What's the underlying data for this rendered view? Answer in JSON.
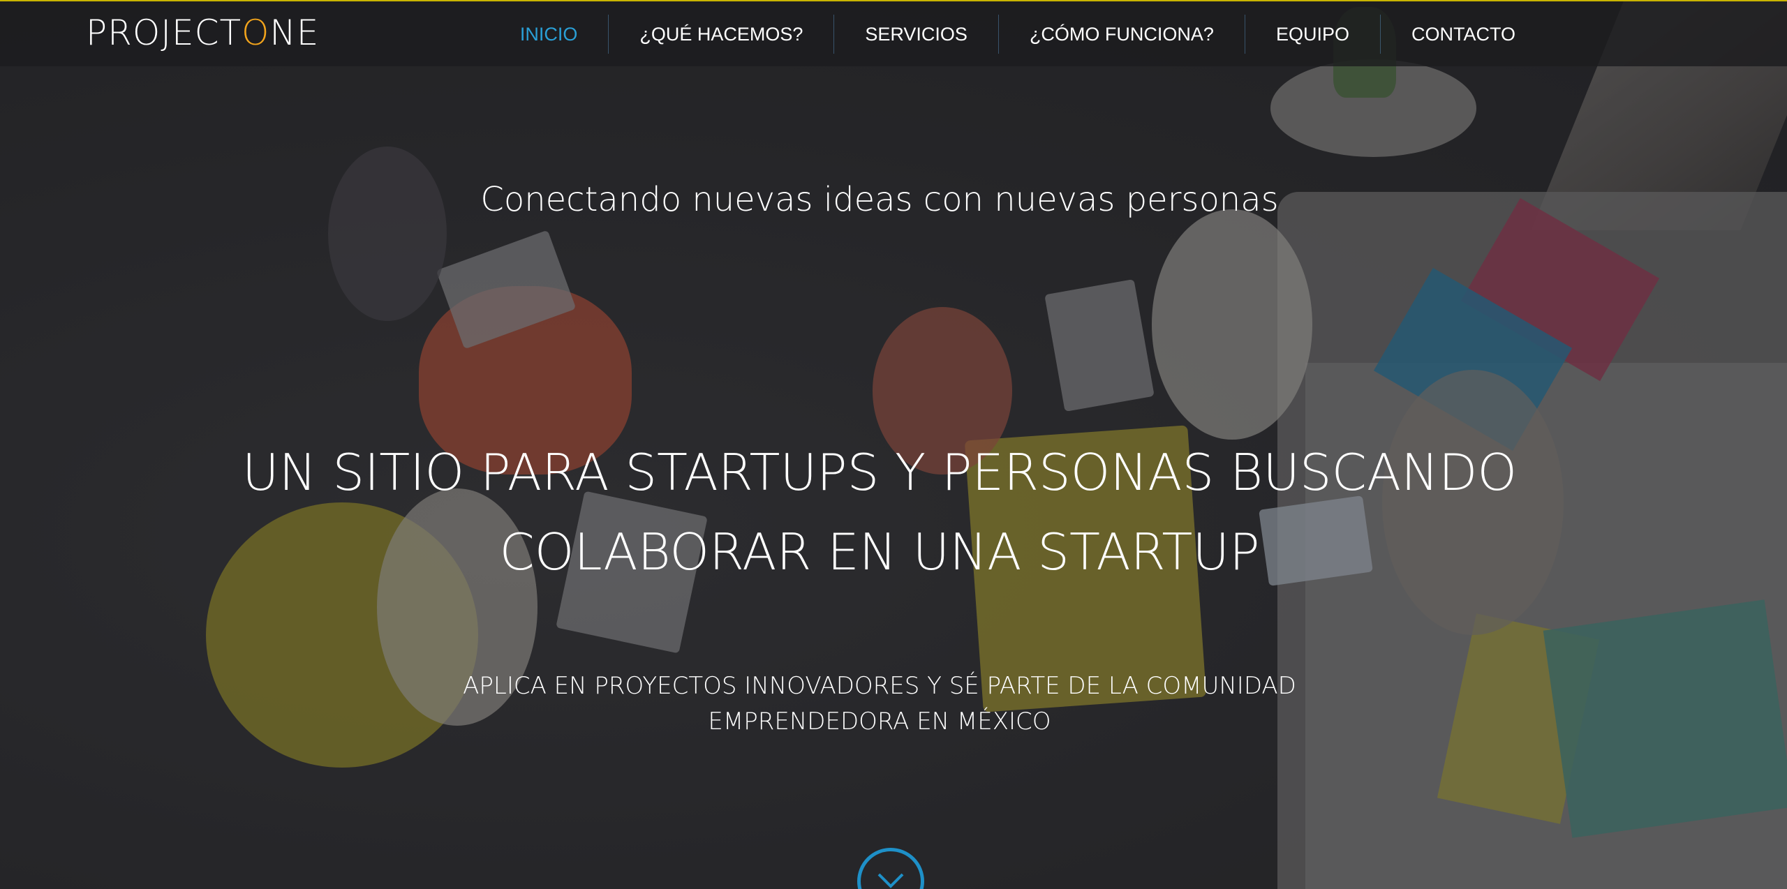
{
  "brand": {
    "logo_prefix": "PROJECT",
    "logo_o": "O",
    "logo_suffix": "NE",
    "accent_color": "#f2a41c"
  },
  "nav": {
    "items": [
      {
        "label": "INICIO",
        "active": true
      },
      {
        "label": "¿QUÉ HACEMOS?",
        "active": false
      },
      {
        "label": "SERVICIOS",
        "active": false
      },
      {
        "label": "¿CÓMO FUNCIONA?",
        "active": false
      },
      {
        "label": "EQUIPO",
        "active": false
      },
      {
        "label": "CONTACTO",
        "active": false
      }
    ],
    "active_color": "#2a9fd6"
  },
  "hero": {
    "tagline": "Conectando nuevas ideas con nuevas personas",
    "headline_line1": "UN SITIO PARA STARTUPS Y PERSONAS BUSCANDO",
    "headline_line2": "COLABORAR EN UNA STARTUP",
    "subline_line1": "APLICA EN PROYECTOS INNOVADORES Y SÉ PARTE DE LA COMUNIDAD",
    "subline_line2": "EMPRENDEDORA EN MÉXICO",
    "scroll_icon": "chevron-down-icon",
    "scroll_color": "#1e90c8"
  }
}
